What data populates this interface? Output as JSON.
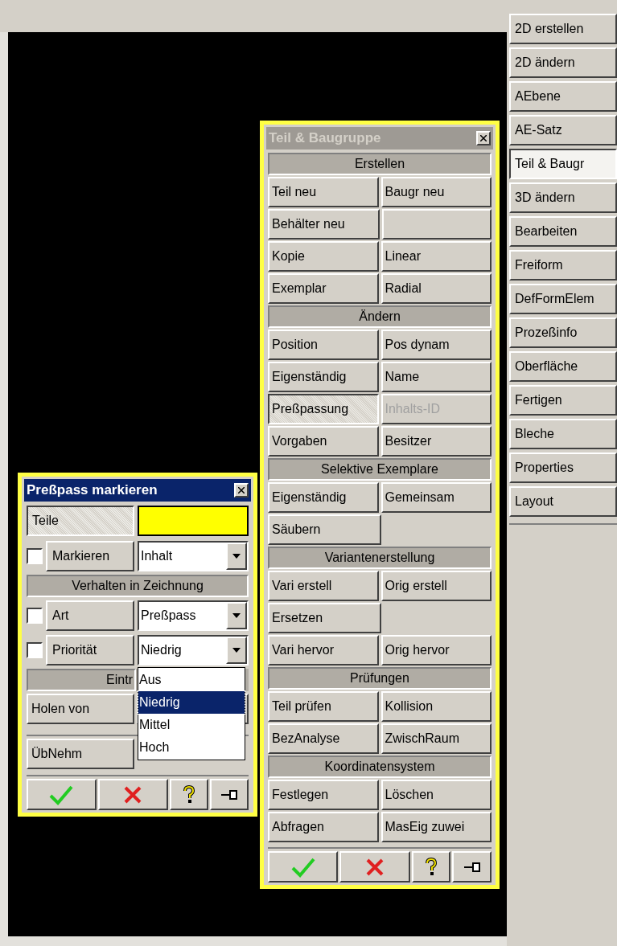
{
  "side_menu": {
    "items": [
      {
        "label": "2D erstellen",
        "selected": false
      },
      {
        "label": "2D ändern",
        "selected": false
      },
      {
        "label": "AEbene",
        "selected": false
      },
      {
        "label": "AE-Satz",
        "selected": false
      },
      {
        "label": "Teil & Baugr",
        "selected": true
      },
      {
        "label": "3D ändern",
        "selected": false
      },
      {
        "label": "Bearbeiten",
        "selected": false
      },
      {
        "label": "Freiform",
        "selected": false
      },
      {
        "label": "DefFormElem",
        "selected": false
      },
      {
        "label": "Prozeßinfo",
        "selected": false
      },
      {
        "label": "Oberfläche",
        "selected": false
      },
      {
        "label": "Fertigen",
        "selected": false
      },
      {
        "label": "Bleche",
        "selected": false
      },
      {
        "label": "Properties",
        "selected": false
      },
      {
        "label": "Layout",
        "selected": false
      }
    ]
  },
  "part_panel": {
    "title": "Teil & Baugruppe",
    "active": false,
    "sections": [
      {
        "heading": "Erstellen",
        "rows": [
          [
            {
              "kind": "button",
              "label": "Teil neu"
            },
            {
              "kind": "button",
              "label": "Baugr neu"
            }
          ],
          [
            {
              "kind": "button",
              "label": "Behälter neu"
            },
            {
              "kind": "blank"
            }
          ],
          [
            {
              "kind": "button",
              "label": "Kopie"
            },
            {
              "kind": "button",
              "label": "Linear"
            }
          ],
          [
            {
              "kind": "button",
              "label": "Exemplar"
            },
            {
              "kind": "button",
              "label": "Radial"
            }
          ]
        ]
      },
      {
        "heading": "Ändern",
        "rows": [
          [
            {
              "kind": "button",
              "label": "Position"
            },
            {
              "kind": "button",
              "label": "Pos dynam"
            }
          ],
          [
            {
              "kind": "button",
              "label": "Eigenständig"
            },
            {
              "kind": "button",
              "label": "Name"
            }
          ],
          [
            {
              "kind": "button",
              "label": "Preßpassung",
              "pressed": true
            },
            {
              "kind": "button",
              "label": "Inhalts-ID",
              "disabled": true
            }
          ],
          [
            {
              "kind": "button",
              "label": "Vorgaben"
            },
            {
              "kind": "button",
              "label": "Besitzer"
            }
          ]
        ]
      },
      {
        "heading": "Selektive Exemplare",
        "rows": [
          [
            {
              "kind": "button",
              "label": "Eigenständig"
            },
            {
              "kind": "button",
              "label": "Gemeinsam"
            }
          ],
          [
            {
              "kind": "button",
              "label": "Säubern"
            },
            {
              "kind": "empty"
            }
          ]
        ]
      },
      {
        "heading": "Variantenerstellung",
        "rows": [
          [
            {
              "kind": "button",
              "label": "Vari erstell"
            },
            {
              "kind": "button",
              "label": "Orig erstell"
            }
          ],
          [
            {
              "kind": "button",
              "label": "Ersetzen"
            },
            {
              "kind": "empty"
            }
          ],
          [
            {
              "kind": "button",
              "label": "Vari hervor"
            },
            {
              "kind": "button",
              "label": "Orig hervor"
            }
          ]
        ]
      },
      {
        "heading": "Prüfungen",
        "rows": [
          [
            {
              "kind": "button",
              "label": "Teil prüfen"
            },
            {
              "kind": "button",
              "label": "Kollision"
            }
          ],
          [
            {
              "kind": "button",
              "label": "BezAnalyse"
            },
            {
              "kind": "button",
              "label": "ZwischRaum"
            }
          ]
        ]
      },
      {
        "heading": "Koordinatensystem",
        "rows": [
          [
            {
              "kind": "button",
              "label": "Festlegen"
            },
            {
              "kind": "button",
              "label": "Löschen"
            }
          ],
          [
            {
              "kind": "button",
              "label": "Abfragen"
            },
            {
              "kind": "button",
              "label": "MasEig zuwei"
            }
          ]
        ]
      }
    ]
  },
  "press_fit_dialog": {
    "title": "Preßpass markieren",
    "active": true,
    "parts_label": "Teile",
    "markieren": {
      "checked": false,
      "label": "Markieren",
      "value": "Inhalt"
    },
    "heading_1": "Verhalten in Zeichnung",
    "art": {
      "checked": false,
      "label": "Art",
      "value": "Preßpass"
    },
    "prioritaet": {
      "checked": false,
      "label": "Priorität",
      "value": "Niedrig",
      "expanded": true,
      "options": [
        {
          "label": "Aus",
          "selected": false
        },
        {
          "label": "Niedrig",
          "selected": true
        },
        {
          "label": "Mittel",
          "selected": false
        },
        {
          "label": "Hoch",
          "selected": false
        }
      ]
    },
    "heading_2": "Eintr",
    "holen_button": "Holen von",
    "uebnehm_button": "ÜbNehm"
  }
}
